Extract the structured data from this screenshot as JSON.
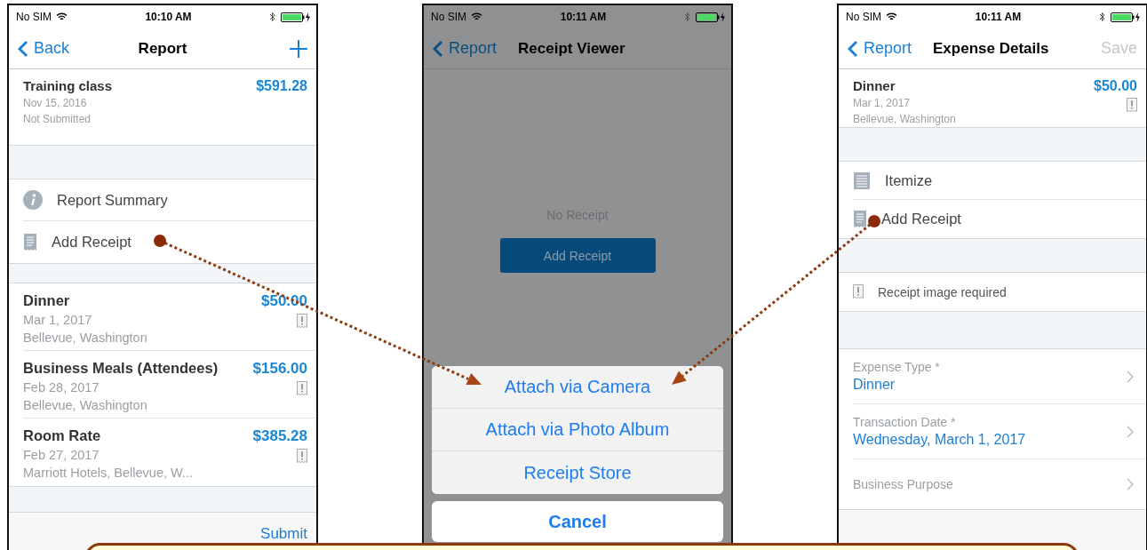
{
  "report_screen": {
    "status_bar": {
      "carrier": "No SIM",
      "time": "10:10 AM"
    },
    "nav": {
      "back": "Back",
      "title": "Report"
    },
    "report": {
      "title": "Training class",
      "amount": "$591.28",
      "date": "Nov 15, 2016",
      "status": "Not Submitted"
    },
    "menu": [
      {
        "kind": "info",
        "label": "Report Summary"
      },
      {
        "kind": "receipt",
        "label": "Add Receipt"
      }
    ],
    "expenses": [
      {
        "title": "Dinner",
        "amount": "$50.00",
        "date": "Mar 1, 2017",
        "location": "Bellevue, Washington",
        "receipt_missing": true
      },
      {
        "title": "Business Meals (Attendees)",
        "amount": "$156.00",
        "date": "Feb 28, 2017",
        "location": "Bellevue, Washington",
        "receipt_missing": true
      },
      {
        "title": "Room Rate",
        "amount": "$385.28",
        "date": "Feb 27, 2017",
        "location": "Marriott Hotels, Bellevue, W...",
        "receipt_missing": true
      }
    ],
    "submit": "Submit"
  },
  "receipt_viewer_screen": {
    "status_bar": {
      "carrier": "No SIM",
      "time": "10:11 AM"
    },
    "nav": {
      "back": "Report",
      "title": "Receipt Viewer"
    },
    "empty_text": "No Receipt",
    "add_button": "Add Receipt",
    "action_sheet": {
      "options": [
        "Attach via Camera",
        "Attach via Photo Album",
        "Receipt Store"
      ],
      "cancel": "Cancel"
    }
  },
  "expense_details_screen": {
    "status_bar": {
      "carrier": "No SIM",
      "time": "10:11 AM"
    },
    "nav": {
      "back": "Report",
      "title": "Expense Details",
      "action": {
        "label": "Save",
        "disabled": true
      }
    },
    "expense": {
      "title": "Dinner",
      "amount": "$50.00",
      "date": "Mar 1, 2017",
      "location": "Bellevue, Washington",
      "receipt_missing": true
    },
    "menu": [
      {
        "kind": "itemize",
        "label": "Itemize"
      },
      {
        "kind": "receipt",
        "label": "Add Receipt"
      }
    ],
    "warning": "Receipt image required",
    "fields": [
      {
        "label": "Expense Type *",
        "value": "Dinner"
      },
      {
        "label": "Transaction Date *",
        "value": "Wednesday, March 1, 2017"
      },
      {
        "label": "Business Purpose"
      }
    ]
  }
}
